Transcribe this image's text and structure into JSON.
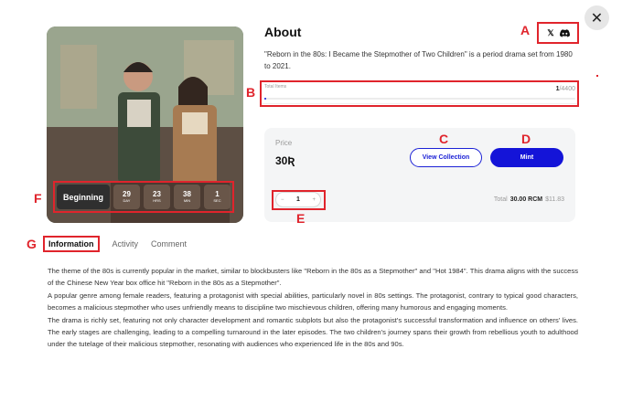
{
  "close": {
    "glyph": "✕"
  },
  "countdown": {
    "label": "Beginning",
    "cells": [
      {
        "num": "29",
        "unit": "DAY"
      },
      {
        "num": "23",
        "unit": "HRS"
      },
      {
        "num": "38",
        "unit": "MIN"
      },
      {
        "num": "1",
        "unit": "SEC"
      }
    ]
  },
  "about": {
    "title": "About",
    "description": "\"Reborn in the 80s: I Became the Stepmother of Two Children\" is a period drama set from 1980 to 2021."
  },
  "social": {
    "x_icon": "x-icon",
    "x_glyph": "𝕏",
    "discord_icon": "discord-icon"
  },
  "total_items": {
    "label": "Total Items",
    "minted": "1",
    "max": "/4400",
    "progress_fraction": 0.000227
  },
  "price": {
    "label": "Price",
    "value": "30",
    "currency_glyph": "Ʀ"
  },
  "buttons": {
    "view_collection": "View Collection",
    "mint": "Mint"
  },
  "quantity": {
    "minus": "−",
    "value": "1",
    "plus": "+"
  },
  "total": {
    "label": "Total",
    "amount": "30.00 RCM",
    "usd": "$11.83"
  },
  "annotations": {
    "a": "A",
    "b": "B",
    "c": "C",
    "d": "D",
    "e": "E",
    "f": "F",
    "g": "G"
  },
  "tabs": {
    "information": "Information",
    "activity": "Activity",
    "comment": "Comment"
  },
  "body_paragraphs": [
    "The theme of the 80s is currently popular in the market, similar to blockbusters like \"Reborn in the 80s as a Stepmother\" and \"Hot 1984\". This drama aligns with the success of the Chinese New Year box office hit \"Reborn in the 80s as a Stepmother\".",
    "A popular genre among female readers, featuring a protagonist with special abilities, particularly novel in 80s settings. The protagonist, contrary to typical good characters, becomes a malicious stepmother who uses unfriendly means to discipline two mischievous children, offering many humorous and engaging moments.",
    "The drama is richly set, featuring not only character development and romantic subplots but also the protagonist's successful transformation and influence on others' lives. The early stages are challenging, leading to a compelling turnaround in the later episodes. The two children's journey spans their growth from rebellious youth to adulthood under the tutelage of their malicious stepmother, resonating with audiences who experienced life in the 80s and 90s."
  ]
}
